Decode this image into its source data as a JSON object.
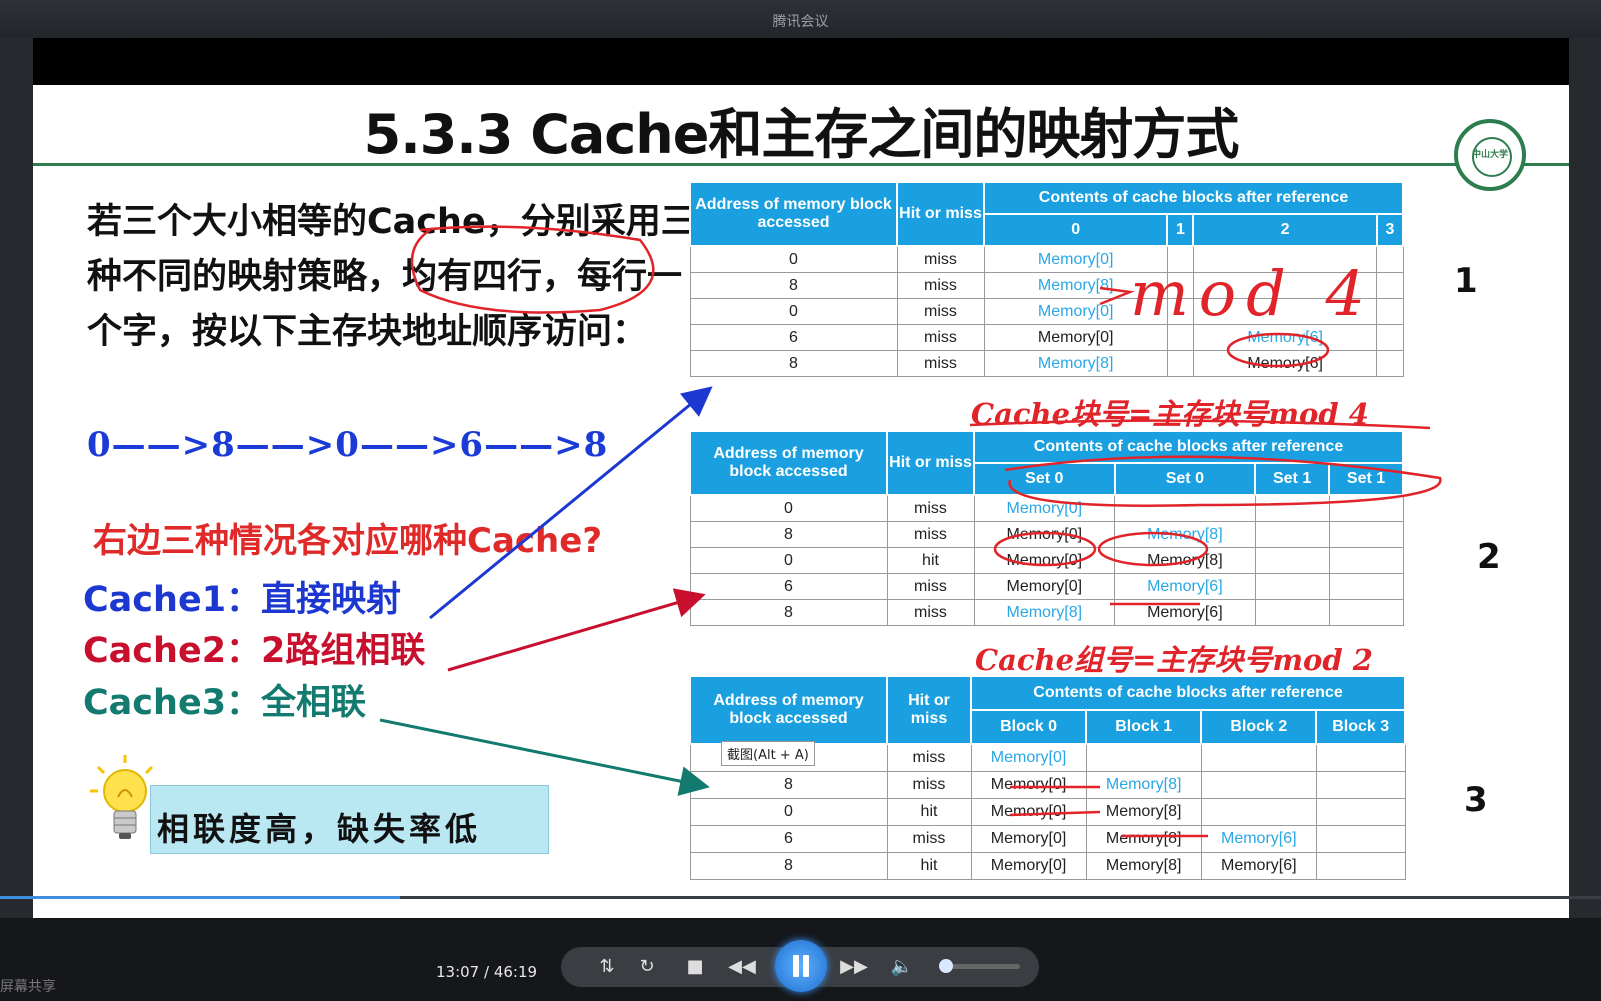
{
  "window": {
    "title": "腾讯会议",
    "sharing_label": "屏幕共享"
  },
  "slide": {
    "title": "5.3.3 Cache和主存之间的映射方式",
    "logo_text": "中山大学",
    "question": "若三个大小相等的Cache，分别采用三种不同的映射策略，均有四行，每行一个字，按以下主存块地址顺序访问：",
    "sequence": "0——>8——>0——>6——>8",
    "ask": "右边三种情况各对应哪种Cache?",
    "cache1": "Cache1：直接映射",
    "cache2": "Cache2：2路组相联",
    "cache3": "Cache3：全相联",
    "note": "相联度高，缺失率低",
    "accent": "#1aa0e0",
    "tables": [
      {
        "label": "1",
        "h_addr": "Address of memory block accessed",
        "h_hit": "Hit or miss",
        "h_contents": "Contents of cache blocks after reference",
        "cols": [
          "0",
          "1",
          "2",
          "3"
        ],
        "rows": [
          [
            "0",
            "miss",
            "Memory[0]",
            "",
            "",
            ""
          ],
          [
            "8",
            "miss",
            "Memory[8]",
            "",
            "",
            ""
          ],
          [
            "0",
            "miss",
            "Memory[0]",
            "",
            "",
            ""
          ],
          [
            "6",
            "miss",
            "Memory[0]",
            "",
            "Memory[6]",
            ""
          ],
          [
            "8",
            "miss",
            "Memory[8]",
            "",
            "Memory[6]",
            ""
          ]
        ]
      },
      {
        "label": "2",
        "h_addr": "Address of memory block accessed",
        "h_hit": "Hit or miss",
        "h_contents": "Contents of cache blocks after reference",
        "cols": [
          "Set 0",
          "Set 0",
          "Set 1",
          "Set 1"
        ],
        "rows": [
          [
            "0",
            "miss",
            "Memory[0]",
            "",
            "",
            ""
          ],
          [
            "8",
            "miss",
            "Memory[0]",
            "Memory[8]",
            "",
            ""
          ],
          [
            "0",
            "hit",
            "Memory[0]",
            "Memory[8]",
            "",
            ""
          ],
          [
            "6",
            "miss",
            "Memory[0]",
            "Memory[6]",
            "",
            ""
          ],
          [
            "8",
            "miss",
            "Memory[8]",
            "Memory[6]",
            "",
            ""
          ]
        ]
      },
      {
        "label": "3",
        "h_addr": "Address of memory block accessed",
        "h_hit": "Hit or miss",
        "h_contents": "Contents of cache blocks after reference",
        "cols": [
          "Block 0",
          "Block 1",
          "Block 2",
          "Block 3"
        ],
        "rows": [
          [
            "0",
            "miss",
            "Memory[0]",
            "",
            "",
            ""
          ],
          [
            "8",
            "miss",
            "Memory[0]",
            "Memory[8]",
            "",
            ""
          ],
          [
            "0",
            "hit",
            "Memory[0]",
            "Memory[8]",
            "",
            ""
          ],
          [
            "6",
            "miss",
            "Memory[0]",
            "Memory[8]",
            "Memory[6]",
            ""
          ],
          [
            "8",
            "hit",
            "Memory[0]",
            "Memory[8]",
            "Memory[6]",
            ""
          ]
        ]
      }
    ],
    "annotations": {
      "mod4": "mod 4",
      "formula1": "Cache块号=主存块号mod 4",
      "formula2": "Cache组号=主存块号mod 2"
    },
    "tooltip": "截图(Alt + A)"
  },
  "player": {
    "time": "13:07 / 46:19",
    "progress": 0.25,
    "volume": 0.1
  }
}
